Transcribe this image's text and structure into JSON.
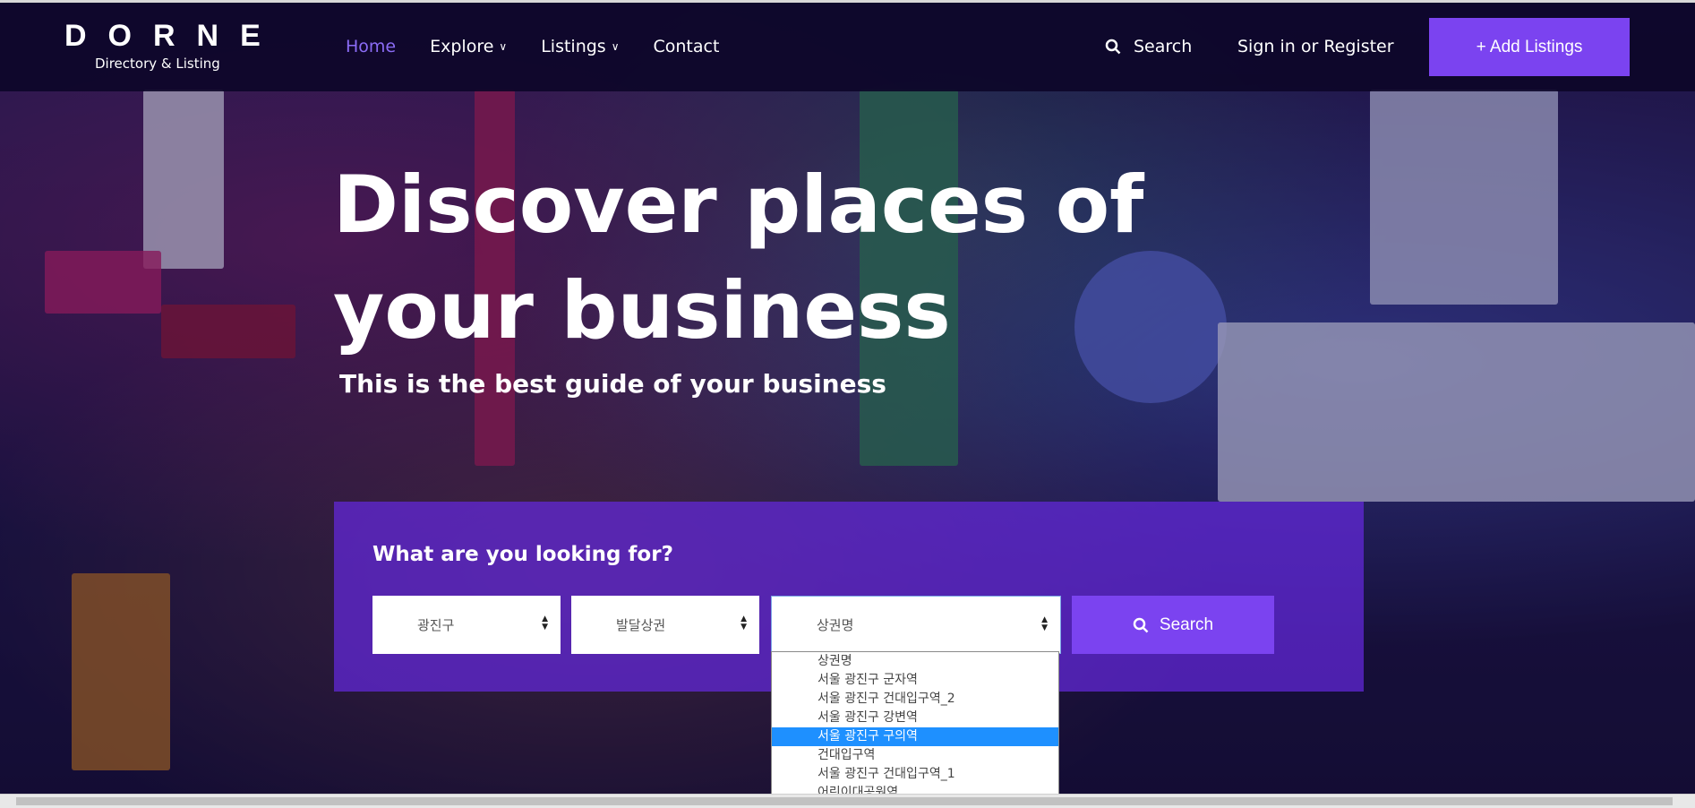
{
  "header": {
    "logo_title": "DORNE",
    "logo_subtitle": "Directory & Listing",
    "nav": [
      {
        "label": "Home",
        "active": true,
        "has_chevron": false
      },
      {
        "label": "Explore",
        "active": false,
        "has_chevron": true
      },
      {
        "label": "Listings",
        "active": false,
        "has_chevron": true
      },
      {
        "label": "Contact",
        "active": false,
        "has_chevron": false
      }
    ],
    "search_label": "Search",
    "signin_label": "Sign in or Register",
    "add_listings_label": "+ Add Listings"
  },
  "hero": {
    "title": "Discover places of your business",
    "subtitle": "This is the best guide of your business"
  },
  "search_panel": {
    "label": "What are you looking for?",
    "select_district": "광진구",
    "select_type": "발달상권",
    "select_area": "상권명",
    "search_button": "Search",
    "dropdown_options": [
      "상권명",
      "서울 광진구 군자역",
      "서울 광진구 건대입구역_2",
      "서울 광진구 강변역",
      "서울 광진구 구의역",
      "건대입구역",
      "서울 광진구 건대입구역_1",
      "어린이대공원역"
    ],
    "dropdown_highlighted": "서울 광진구 구의역"
  },
  "colors": {
    "accent": "#7b43f0",
    "active_nav": "#8b6cf6",
    "dropdown_highlight": "#1e90ff"
  },
  "icons": {
    "search": "search-icon",
    "chevron": "chevron-down-icon",
    "select_arrows": "sort-arrows-icon"
  }
}
